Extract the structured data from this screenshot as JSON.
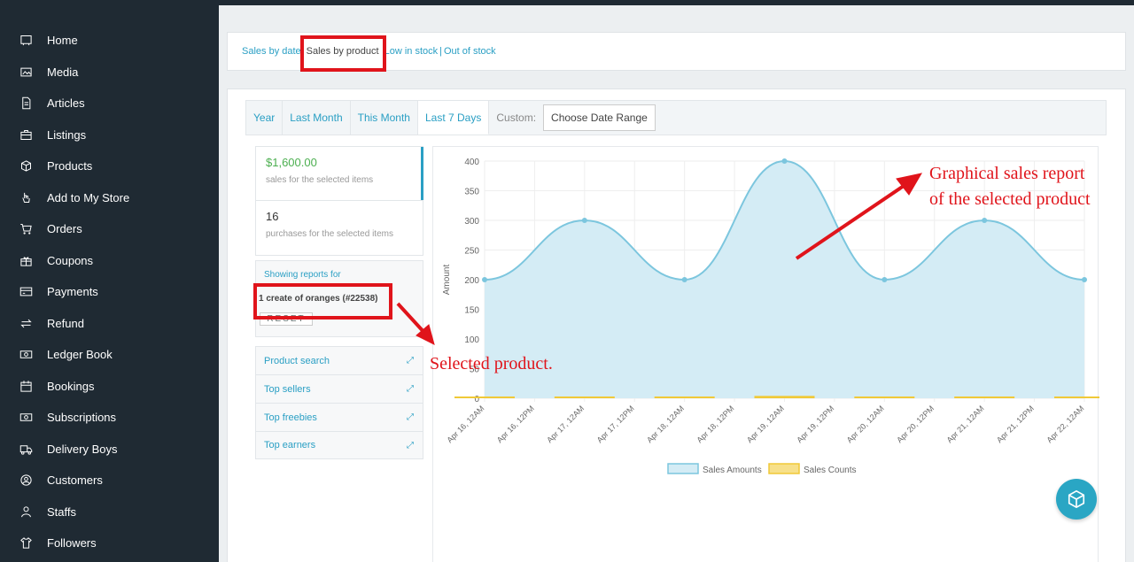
{
  "sidebar": {
    "items": [
      {
        "label": "Home",
        "icon": "home-icon"
      },
      {
        "label": "Media",
        "icon": "image-icon"
      },
      {
        "label": "Articles",
        "icon": "document-icon"
      },
      {
        "label": "Listings",
        "icon": "briefcase-icon"
      },
      {
        "label": "Products",
        "icon": "cube-icon"
      },
      {
        "label": "Add to My Store",
        "icon": "hand-pointer-icon"
      },
      {
        "label": "Orders",
        "icon": "cart-icon"
      },
      {
        "label": "Coupons",
        "icon": "gift-icon"
      },
      {
        "label": "Payments",
        "icon": "credit-card-icon"
      },
      {
        "label": "Refund",
        "icon": "refund-arrows-icon"
      },
      {
        "label": "Ledger Book",
        "icon": "money-icon"
      },
      {
        "label": "Bookings",
        "icon": "calendar-icon"
      },
      {
        "label": "Subscriptions",
        "icon": "money-icon"
      },
      {
        "label": "Delivery Boys",
        "icon": "truck-icon"
      },
      {
        "label": "Customers",
        "icon": "user-circle-icon"
      },
      {
        "label": "Staffs",
        "icon": "user-icon"
      },
      {
        "label": "Followers",
        "icon": "shirt-icon"
      }
    ]
  },
  "report_links": {
    "sales_by_date": "Sales by date",
    "sales_by_product": "Sales by product",
    "low_in_stock": "Low in stock",
    "separator": "|",
    "out_of_stock": "Out of stock"
  },
  "tabs": {
    "year": "Year",
    "last_month": "Last Month",
    "this_month": "This Month",
    "last_7_days": "Last 7 Days",
    "custom_label": "Custom:",
    "date_range": "Choose Date Range"
  },
  "stats": {
    "sales_value": "$1,600.00",
    "sales_desc": "sales for the selected items",
    "purchases_value": "16",
    "purchases_desc": "purchases for the selected items"
  },
  "showing": {
    "header": "Showing reports for",
    "product": "1 create of oranges (#22538)",
    "reset": "RESET"
  },
  "side_list": [
    "Product search",
    "Top sellers",
    "Top freebies",
    "Top earners"
  ],
  "annotations": {
    "chart": "Graphical sales report\nof the selected product",
    "product": "Selected product."
  },
  "colors": {
    "sidebar_bg": "#1f2a33",
    "accent": "#2a9fc4",
    "annotation_red": "#e0141b",
    "area_fill": "#d4ecf5",
    "line": "#7cc6de",
    "counts": "#f0c938"
  },
  "chart_data": {
    "type": "line",
    "ylabel": "Amount",
    "ylim": [
      0,
      400
    ],
    "yticks": [
      0,
      50,
      100,
      150,
      200,
      250,
      300,
      350,
      400
    ],
    "x_tick_labels": [
      "Apr 16, 12AM",
      "Apr 16, 12PM",
      "Apr 17, 12AM",
      "Apr 17, 12PM",
      "Apr 18, 12AM",
      "Apr 18, 12PM",
      "Apr 19, 12AM",
      "Apr 19, 12PM",
      "Apr 20, 12AM",
      "Apr 20, 12PM",
      "Apr 21, 12AM",
      "Apr 21, 12PM",
      "Apr 22, 12AM"
    ],
    "series": [
      {
        "name": "Sales Amounts",
        "values": [
          200,
          300,
          200,
          400,
          200,
          300,
          200
        ]
      },
      {
        "name": "Sales Counts",
        "values": [
          2,
          2,
          2,
          4,
          2,
          2,
          2
        ]
      }
    ],
    "legend": "bottom",
    "grid": true
  }
}
